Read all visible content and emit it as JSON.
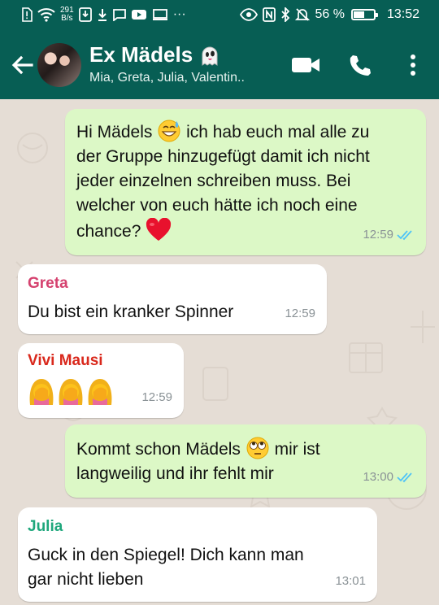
{
  "status_bar": {
    "net_speed_value": "291",
    "net_speed_unit": "B/s",
    "more_dots": "···",
    "battery_percent_label": "56 %",
    "battery_level": 0.56,
    "time": "13:52"
  },
  "header": {
    "title": "Ex Mädels",
    "title_emoji": "ghost",
    "subtitle": "Mia, Greta, Julia, Valentin..",
    "actions": [
      "video-call",
      "voice-call",
      "more"
    ]
  },
  "colors": {
    "header_bg": "#075e54",
    "outgoing_bubble": "#dcf8c6",
    "incoming_bubble": "#ffffff",
    "read_ticks": "#4fc3f7",
    "greta_name": "#d5426f",
    "vivi_name": "#d9281c",
    "julia_name": "#1fa77c"
  },
  "messages": [
    {
      "direction": "out",
      "lines": [
        "Hi Mädels",
        "ich hab euch mal alle zu",
        "der Gruppe hinzugefügt damit ich nicht",
        "jeder einzelnen schreiben muss. Bei",
        "welcher von euch hätte ich noch eine",
        "chance?"
      ],
      "emojis": [
        "grinning-sweat-face",
        "red-heart"
      ],
      "time": "12:59",
      "status": "read"
    },
    {
      "direction": "in",
      "sender": "Greta",
      "text": "Du bist ein kranker Spinner",
      "time": "12:59"
    },
    {
      "direction": "in",
      "sender": "Vivi Mausi",
      "emojis": [
        "woman-facepalming",
        "woman-facepalming",
        "woman-facepalming"
      ],
      "time": "12:59"
    },
    {
      "direction": "out",
      "lines": [
        "Kommt schon Mädels",
        "mir ist",
        "langweilig und ihr fehlt mir"
      ],
      "emojis": [
        "face-with-rolling-eyes"
      ],
      "time": "13:00",
      "status": "read"
    },
    {
      "direction": "in",
      "sender": "Julia",
      "lines": [
        "Guck in den Spiegel! Dich kann man",
        "gar nicht lieben"
      ],
      "time": "13:01"
    }
  ]
}
